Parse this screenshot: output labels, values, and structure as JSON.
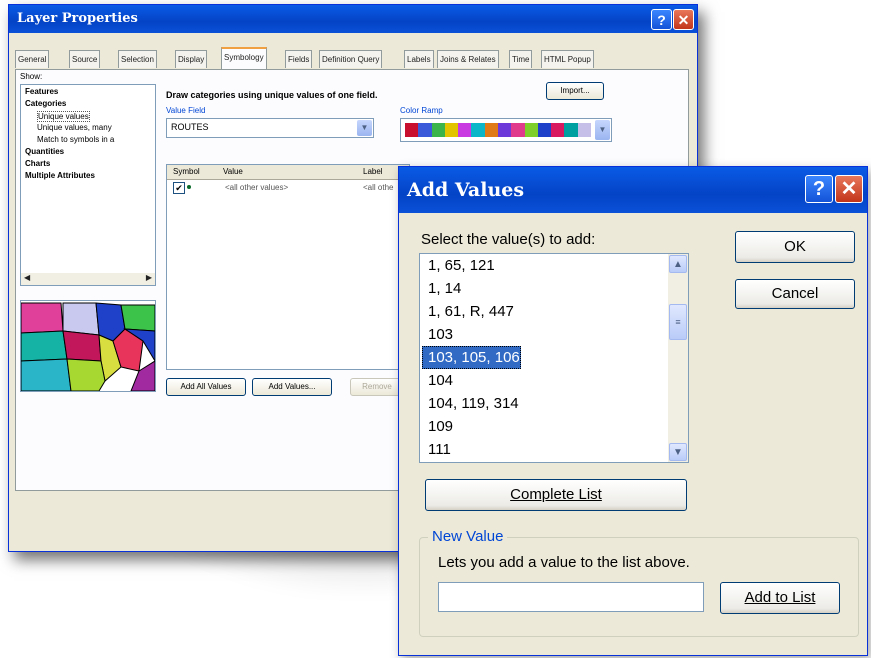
{
  "layer_properties": {
    "title": "Layer Properties",
    "tabs": [
      "General",
      "Source",
      "Selection",
      "Display",
      "Symbology",
      "Fields",
      "Definition Query",
      "Labels",
      "Joins & Relates",
      "Time",
      "HTML Popup"
    ],
    "selected_tab": "Symbology",
    "show_label": "Show:",
    "tree": {
      "features": "Features",
      "categories": "Categories",
      "unique_values": "Unique values",
      "unique_values_many": "Unique values, many",
      "match_symbols": "Match to symbols in a",
      "quantities": "Quantities",
      "charts": "Charts",
      "multiple_attributes": "Multiple Attributes"
    },
    "heading": "Draw categories using unique values of one field.",
    "import_button": "Import...",
    "value_field_label": "Value Field",
    "value_field_value": "ROUTES",
    "color_ramp_label": "Color Ramp",
    "color_ramp_colors": [
      "#c8102e",
      "#3a5ad9",
      "#3bb54a",
      "#e3c400",
      "#c93ae0",
      "#0bb6c8",
      "#e07a16",
      "#6d3ad9",
      "#e03a8d",
      "#7fcf2a",
      "#1f40c8",
      "#d81b60",
      "#00a0a0",
      "#c6c0e8"
    ],
    "columns": {
      "symbol": "Symbol",
      "value": "Value",
      "label": "Label"
    },
    "row": {
      "value": "<all other values>",
      "label": "<all othe"
    },
    "add_all_values_button": "Add All Values",
    "add_values_button": "Add Values...",
    "remove_button": "Remove"
  },
  "add_values": {
    "title": "Add Values",
    "select_label": "Select the value(s) to add:",
    "items": [
      "1, 65, 121",
      "1, 14",
      "1, 61, R, 447",
      "103",
      "103, 105, 106",
      "104",
      "104, 119, 314",
      "109",
      "111"
    ],
    "selected_item": "103, 105, 106",
    "ok_button": "OK",
    "cancel_button": "Cancel",
    "complete_list_button": "Complete List",
    "new_value_legend": "New Value",
    "new_value_hint": "Lets you add a value to the list above.",
    "new_value_input": "",
    "add_to_list_button": "Add to List"
  }
}
